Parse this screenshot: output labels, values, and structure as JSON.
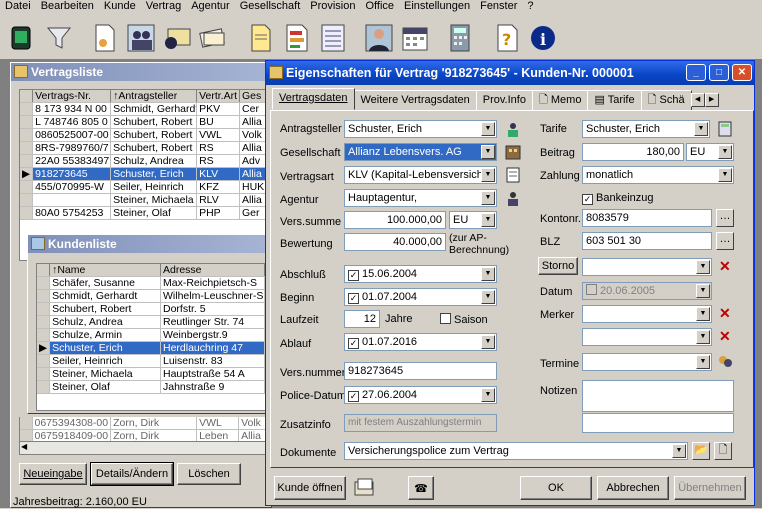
{
  "menu": [
    "Datei",
    "Bearbeiten",
    "Kunde",
    "Vertrag",
    "Agentur",
    "Gesellschaft",
    "Provision",
    "Office",
    "Einstellungen",
    "Fenster",
    "?"
  ],
  "toolbar": {
    "icons": [
      "terminal-icon",
      "filter-icon",
      "document-icon",
      "people-icon",
      "mailing-icon",
      "cards-icon",
      "report-icon",
      "contract-icon",
      "list-icon",
      "person-icon",
      "calendar-icon",
      "calculator-icon",
      "help-icon",
      "info-icon"
    ]
  },
  "vertragsliste": {
    "title": "Vertragsliste",
    "headers": [
      "Vertrags-Nr.",
      "↑Antragsteller",
      "Vertr.Art",
      "Ges"
    ],
    "rows": [
      [
        "8 173 934 N 00",
        "Schmidt, Gerhardt",
        "PKV",
        "Cer"
      ],
      [
        "L 748746 805 0",
        "Schubert, Robert",
        "BU",
        "Allia"
      ],
      [
        "0860525007-00",
        "Schubert, Robert",
        "VWL",
        "Volk"
      ],
      [
        "8RS-7989760/7",
        "Schubert, Robert",
        "RS",
        "Allia"
      ],
      [
        "22A0 55383497",
        "Schulz, Andrea",
        "RS",
        "Adv"
      ],
      [
        "918273645",
        "Schuster, Erich",
        "KLV",
        "Allia"
      ],
      [
        "455/070995-W",
        "Seiler, Heinrich",
        "KFZ",
        "HUK"
      ],
      [
        "",
        "Steiner, Michaela",
        "RLV",
        "Allia"
      ],
      [
        "80A0 5754253",
        "Steiner, Olaf",
        "PHP",
        "Ger"
      ]
    ],
    "extra_rows": [
      [
        "0675394308-00",
        "Zorn, Dirk",
        "VWL",
        "Volk"
      ],
      [
        "0675918409-00",
        "Zorn, Dirk",
        "Leben",
        "Allia"
      ]
    ],
    "buttons": {
      "neueingabe": "Neueingabe",
      "details": "Details/Ändern",
      "loeschen": "Löschen"
    },
    "status": "Jahresbeitrag: 2.160,00 EU"
  },
  "kundenliste": {
    "title": "Kundenliste",
    "headers": [
      "↑Name",
      "Adresse"
    ],
    "rows": [
      [
        "Schäfer, Susanne",
        "Max-Reichpietsch-S"
      ],
      [
        "Schmidt, Gerhardt",
        "Wilhelm-Leuschner-S"
      ],
      [
        "Schubert, Robert",
        "Dorfstr. 5"
      ],
      [
        "Schulz, Andrea",
        "Reutlinger Str. 74"
      ],
      [
        "Schulze, Armin",
        "Weinbergstr.9"
      ],
      [
        "Schuster, Erich",
        "Herdlauchring 47"
      ],
      [
        "Seiler, Heinrich",
        "Luisenstr. 83"
      ],
      [
        "Steiner, Michaela",
        "Hauptstraße 54 A"
      ],
      [
        "Steiner, Olaf",
        "Jahnstraße 9"
      ]
    ]
  },
  "dialog": {
    "title": "Eigenschaften für Vertrag '918273645' - Kunden-Nr. 000001",
    "tabs": [
      "Vertragsdaten",
      "Weitere Vertragsdaten",
      "Prov.Info",
      "Memo",
      "Tarife",
      "Schä"
    ],
    "left": {
      "antragsteller_label": "Antragsteller",
      "antragsteller": "Schuster, Erich",
      "gesellschaft_label": "Gesellschaft",
      "gesellschaft": "Allianz Lebensvers. AG",
      "vertragsart_label": "Vertragsart",
      "vertragsart": "KLV (Kapital-Lebensversicher",
      "agentur_label": "Agentur",
      "agentur": "Hauptagentur,",
      "summe_label": "Vers.summe",
      "summe": "100.000,00",
      "summe_cur": "EU",
      "bewertung_label": "Bewertung",
      "bewertung": "40.000,00",
      "bewertung_note": "(zur AP-Berechnung)",
      "abschluss_label": "Abschluß",
      "abschluss": "15.06.2004",
      "beginn_label": "Beginn",
      "beginn": "01.07.2004",
      "laufzeit_label": "Laufzeit",
      "laufzeit": "12",
      "jahre": "Jahre",
      "saison": "Saison",
      "ablauf_label": "Ablauf",
      "ablauf": "01.07.2016",
      "versnr_label": "Vers.nummer",
      "versnr": "918273645",
      "police_label": "Police-Datum",
      "police": "27.06.2004",
      "zusatz_label": "Zusatzinfo",
      "zusatz": "mit festem Auszahlungstermin",
      "dokumente_label": "Dokumente",
      "dokumente": "Versicherungspolice zum Vertrag"
    },
    "right": {
      "tarife_label": "Tarife",
      "tarife": "Schuster, Erich",
      "beitrag_label": "Beitrag",
      "beitrag": "180,00",
      "beitrag_cur": "EU",
      "zahlung_label": "Zahlung",
      "zahlung": "monatlich",
      "bankeinzug": "Bankeinzug",
      "kontonr_label": "Kontonr.",
      "kontonr": "8083579",
      "blz_label": "BLZ",
      "blz": "603 501 30",
      "storno": "Storno",
      "datum_label": "Datum",
      "datum": "20.06.2005",
      "merker_label": "Merker",
      "termine_label": "Termine",
      "notizen_label": "Notizen"
    },
    "buttons": {
      "kunde": "Kunde öffnen",
      "ok": "OK",
      "abbrechen": "Abbrechen",
      "uebernehmen": "Übernehmen"
    }
  }
}
